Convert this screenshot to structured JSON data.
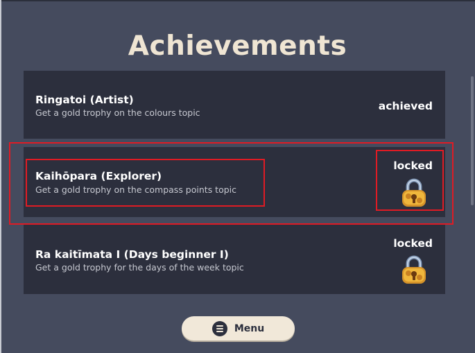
{
  "page": {
    "title": "Achievements",
    "background_color": "#454b5e",
    "panel_color": "#2c2f3d",
    "title_color": "#efe5d3",
    "highlight_color": "#e01b24"
  },
  "achievements": [
    {
      "name": "Ringatoi (Artist)",
      "description": "Get a gold trophy on the colours topic",
      "status": "achieved",
      "icon": null
    },
    {
      "name": "Kaihōpara (Explorer)",
      "description": "Get a gold trophy on the compass points topic",
      "status": "locked",
      "icon": "gold-padlock-icon"
    },
    {
      "name": "Ra kaitīmata I (Days beginner I)",
      "description": "Get a gold trophy for the days of the week topic",
      "status": "locked",
      "icon": "gold-padlock-icon"
    }
  ],
  "menu": {
    "label": "Menu",
    "icon": "hamburger-menu-icon"
  }
}
